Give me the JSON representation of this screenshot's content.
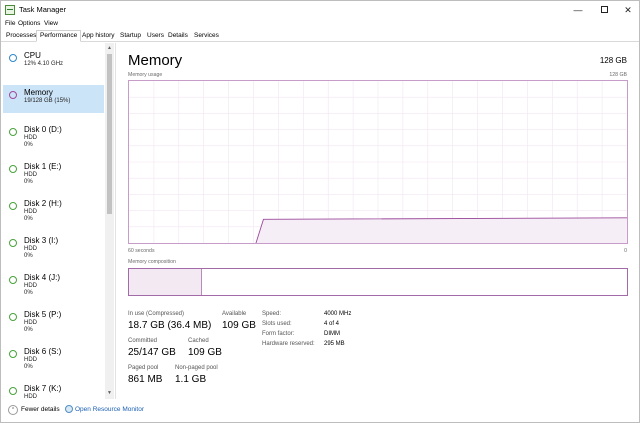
{
  "window": {
    "title": "Task Manager"
  },
  "menu": [
    "File",
    "Options",
    "View"
  ],
  "tabs": [
    {
      "label": "Processes",
      "active": false
    },
    {
      "label": "Performance",
      "active": true
    },
    {
      "label": "App history",
      "active": false
    },
    {
      "label": "Startup",
      "active": false
    },
    {
      "label": "Users",
      "active": false
    },
    {
      "label": "Details",
      "active": false
    },
    {
      "label": "Services",
      "active": false
    }
  ],
  "sidebar": {
    "items": [
      {
        "title": "CPU",
        "sub": "12%  4.10 GHz",
        "sub2": "",
        "kind": "cpu",
        "selected": false
      },
      {
        "title": "Memory",
        "sub": "19/128 GB (15%)",
        "sub2": "",
        "kind": "mem",
        "selected": true
      },
      {
        "title": "Disk 0 (D:)",
        "sub": "HDD",
        "sub2": "0%",
        "kind": "disk",
        "selected": false
      },
      {
        "title": "Disk 1 (E:)",
        "sub": "HDD",
        "sub2": "0%",
        "kind": "disk",
        "selected": false
      },
      {
        "title": "Disk 2 (H:)",
        "sub": "HDD",
        "sub2": "0%",
        "kind": "disk",
        "selected": false
      },
      {
        "title": "Disk 3 (I:)",
        "sub": "HDD",
        "sub2": "0%",
        "kind": "disk",
        "selected": false
      },
      {
        "title": "Disk 4 (J:)",
        "sub": "HDD",
        "sub2": "0%",
        "kind": "disk",
        "selected": false
      },
      {
        "title": "Disk 5 (P:)",
        "sub": "HDD",
        "sub2": "0%",
        "kind": "disk",
        "selected": false
      },
      {
        "title": "Disk 6 (S:)",
        "sub": "HDD",
        "sub2": "0%",
        "kind": "disk",
        "selected": false
      },
      {
        "title": "Disk 7 (K:)",
        "sub": "HDD",
        "sub2": "0%",
        "kind": "disk",
        "selected": false
      }
    ]
  },
  "main": {
    "title": "Memory",
    "total": "128 GB",
    "usage_label": "Memory usage",
    "usage_max": "128 GB",
    "time_left": "60 seconds",
    "time_right": "0",
    "composition_label": "Memory composition",
    "composition_in_use_fraction": 0.146
  },
  "stats": {
    "in_use_label": "In use (Compressed)",
    "in_use_value": "18.7 GB (36.4 MB)",
    "available_label": "Available",
    "available_value": "109 GB",
    "committed_label": "Committed",
    "committed_value": "25/147 GB",
    "cached_label": "Cached",
    "cached_value": "109 GB",
    "paged_label": "Paged pool",
    "paged_value": "861 MB",
    "nonpaged_label": "Non-paged pool",
    "nonpaged_value": "1.1 GB"
  },
  "specs": [
    {
      "label": "Speed:",
      "value": "4000 MHz"
    },
    {
      "label": "Slots used:",
      "value": "4 of 4"
    },
    {
      "label": "Form factor:",
      "value": "DIMM"
    },
    {
      "label": "Hardware reserved:",
      "value": "295 MB"
    }
  ],
  "footer": {
    "fewer_details": "Fewer details",
    "open_resource_monitor": "Open Resource Monitor"
  },
  "colors": {
    "memory_accent": "#9b4a9b",
    "selected_bg": "#cce4f7",
    "link": "#1a5fb4"
  },
  "icons": {
    "app": "task-manager-icon",
    "fewer": "chevron-up-icon",
    "resource": "resource-monitor-icon"
  }
}
